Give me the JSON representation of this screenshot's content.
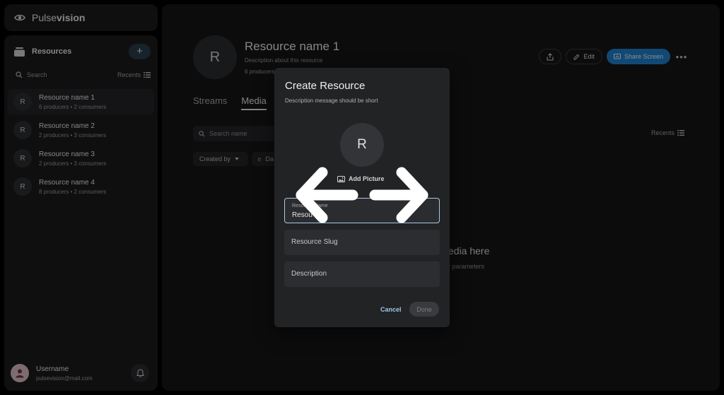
{
  "app": {
    "brand_prefix": "Pulse",
    "brand_suffix": "vision"
  },
  "sidebar": {
    "title": "Resources",
    "add_label": "+",
    "search_label": "Search",
    "recents_label": "Recents",
    "items": [
      {
        "avatar": "R",
        "name": "Resource name 1",
        "meta": "6 producers • 2 consumers",
        "active": true
      },
      {
        "avatar": "R",
        "name": "Resource name 2",
        "meta": "2 producers • 3 consumers"
      },
      {
        "avatar": "R",
        "name": "Resource name 3",
        "meta": "2 producers • 3 consumers"
      },
      {
        "avatar": "R",
        "name": "Resource name 4",
        "meta": "8 producers • 2 consumers"
      }
    ],
    "user": {
      "name": "Username",
      "email": "pulsevision@mail.com"
    }
  },
  "main": {
    "avatar": "R",
    "title": "Resource name 1",
    "description": "Description about this resource",
    "subline": "6 producers",
    "edit_label": "Edit",
    "share_label": "Share Screen",
    "more_label": "•••",
    "tabs": [
      "Streams",
      "Media"
    ],
    "search_placeholder": "Search name",
    "recents_label": "Recents",
    "filter_created": "Created by",
    "filter_date": "Da",
    "empty_title": "edia here",
    "empty_sub": "r parameters"
  },
  "modal": {
    "title": "Create Resource",
    "description": "Description message should be short",
    "avatar": "R",
    "add_picture": "Add Picture",
    "name_label": "Resource Name",
    "name_value": "Resou",
    "slug_placeholder": "Resource Slug",
    "description_placeholder": "Description",
    "cancel": "Cancel",
    "done": "Done"
  },
  "colors": {
    "accent": "#1f7fc8",
    "focus_border": "#a9c8e6",
    "cancel_text": "#9fc5e8"
  }
}
